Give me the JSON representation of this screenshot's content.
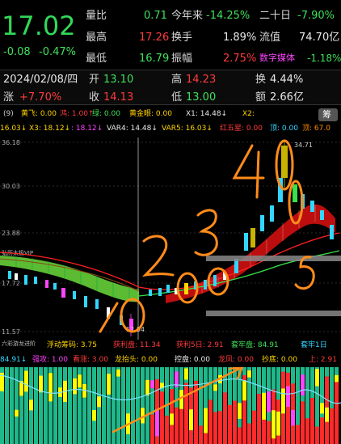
{
  "quote": {
    "price": "17.02",
    "change": "-0.08",
    "change_pct": "-0.47%",
    "stats": [
      {
        "label": "量比",
        "value": "0.71",
        "label2": "今年来",
        "value2": "-14.25%",
        "label3": "二十日",
        "value3": "-7.90%"
      },
      {
        "label": "最高",
        "value": "17.26",
        "label2": "换手",
        "value2": "1.89%",
        "label3": "流值",
        "value3": "74.70亿"
      },
      {
        "label": "最低",
        "value": "16.79",
        "label2": "振幅",
        "value2": "2.75%",
        "label3": "数字媒体",
        "value3": "-1.18%"
      }
    ]
  },
  "day": {
    "date": "2024/02/08/四",
    "open_label": "开",
    "open": "13.10",
    "high_label": "高",
    "high": "14.23",
    "turn_label": "换",
    "turn": "4.44%",
    "rise_label": "涨",
    "rise": "+7.70%",
    "close_label": "收",
    "close": "14.13",
    "low_label": "低",
    "low": "13.00",
    "amount_label": "额",
    "amount": "2.66亿"
  },
  "indicator1": {
    "name": "弘历太极VIP",
    "params": "(9)",
    "items": [
      {
        "text": "黄飞: 0.00",
        "color": "#ffd400"
      },
      {
        "text": "鸿: 1.00↑",
        "color": "#ff3b3b"
      },
      {
        "text": "绿: 0.00",
        "color": "#3fe05a"
      },
      {
        "text": "黄金眼: 0.00",
        "color": "#ffd400"
      },
      {
        "text": "X1: 14.48↓",
        "color": "#e8e8e8"
      },
      {
        "text": "X2:",
        "color": "#ffd400"
      }
    ],
    "items2": [
      {
        "text": "16.03↓",
        "color": "#ffd400"
      },
      {
        "text": "X3: 18.12↓",
        "color": "#ffd400"
      },
      {
        "text": ": 18.12↓",
        "color": "#ff44ff"
      },
      {
        "text": "VAR4: 14.48↓",
        "color": "#e8e8e8"
      },
      {
        "text": "VAR5: 16.03↓",
        "color": "#ffd400"
      },
      {
        "text": "红五星: 0.00",
        "color": "#ff3b3b"
      },
      {
        "text": "顶: 0.00",
        "color": "#33d6ff"
      },
      {
        "text": "顶: 67.0",
        "color": "#ff8800"
      }
    ],
    "sell_label": "筹",
    "price_levels": [
      "36.18",
      "30.03",
      "23.88",
      "17.72",
      "11.57"
    ],
    "kline_label": "K线",
    "high_mark": "34.71",
    "low_mark": "12.04"
  },
  "indicator2": {
    "name": "六彩游龙进阶",
    "items": [
      {
        "text": "浮动筹码: 3.75",
        "color": "#ffd400"
      },
      {
        "text": "获利盘: 11.34",
        "color": "#ff3b3b"
      },
      {
        "text": "获利5日: 2.91",
        "color": "#ff3b3b"
      },
      {
        "text": "套牢盘: 84.91",
        "color": "#3fe05a"
      },
      {
        "text": "套牢1日",
        "color": "#33d6ff"
      }
    ],
    "items2": [
      {
        "text": "84.91↓",
        "color": "#33d6ff"
      },
      {
        "text": "强攻: 1.00",
        "color": "#ff44ff"
      },
      {
        "text": "看涨: 3.00",
        "color": "#ff3b3b"
      },
      {
        "text": "龙抬头: 0.00",
        "color": "#ffd400"
      },
      {
        "text": "控盘: 0.00",
        "color": "#e8e8e8"
      },
      {
        "text": "龙凤: 0.00",
        "color": "#ff3b3b"
      },
      {
        "text": "抄底: 0.00",
        "color": "#ffd400"
      },
      {
        "text": "上: 2.91",
        "color": "#ff3b3b"
      }
    ]
  },
  "annotations": {
    "n1": "1",
    "n2": "2",
    "n3": "3",
    "n4": "4",
    "n5": "5"
  }
}
